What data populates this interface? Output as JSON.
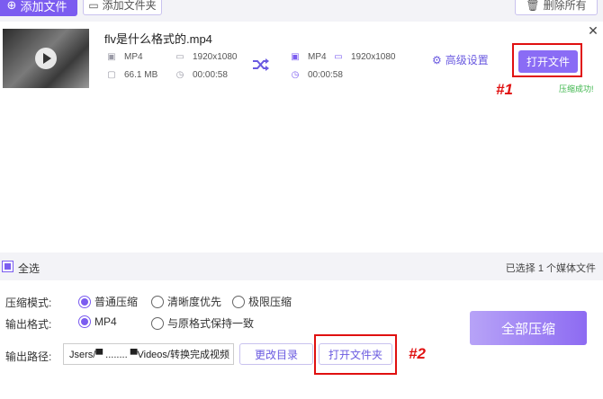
{
  "toolbar": {
    "add_file": "添加文件",
    "add_folder": "添加文件夹",
    "delete_all": "删除所有"
  },
  "file": {
    "name": "flv是什么格式的.mp4",
    "source": {
      "format": "MP4",
      "resolution": "1920x1080",
      "size": "66.1 MB",
      "duration": "00:00:58"
    },
    "output": {
      "format": "MP4",
      "resolution": "1920x1080",
      "duration": "00:00:58"
    },
    "advanced_settings": "高级设置",
    "open_file": "打开文件",
    "status": "压缩成功!"
  },
  "annotations": {
    "first": "#1",
    "second": "#2"
  },
  "selection": {
    "select_all": "全选",
    "count_text": "已选择 1 个媒体文件"
  },
  "settings": {
    "mode_label": "压缩模式:",
    "modes": [
      "普通压缩",
      "清晰度优先",
      "极限压缩"
    ],
    "format_label": "输出格式:",
    "formats": [
      "MP4",
      "与原格式保持一致"
    ],
    "path_label": "输出路径:",
    "path_value": "Jsers/▀ ........ ▀Videos/转换完成视频",
    "change_dir": "更改目录",
    "open_folder": "打开文件夹",
    "compress_all": "全部压缩"
  },
  "colors": {
    "accent": "#7b5cf0",
    "annotation": "#e01010",
    "success": "#3bb54a"
  }
}
